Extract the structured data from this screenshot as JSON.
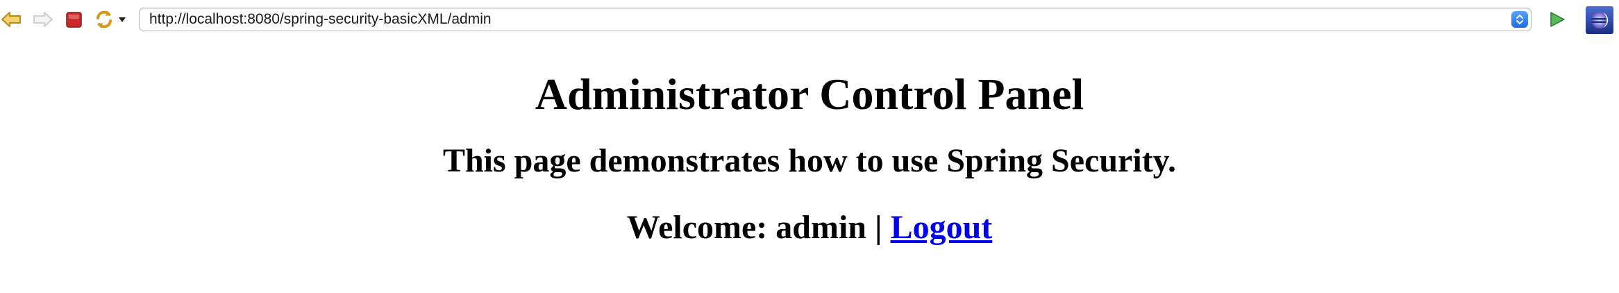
{
  "browser": {
    "url": "http://localhost:8080/spring-security-basicXML/admin",
    "icons": {
      "back": "back-arrow-icon",
      "forward": "forward-arrow-icon",
      "stop": "stop-icon",
      "refresh": "refresh-icon",
      "refresh_menu": "chevron-down-icon",
      "url_menu": "chevron-updown-icon",
      "go": "go-play-icon",
      "logo": "eclipse-logo-icon"
    },
    "colors": {
      "stop": "#cc2b2b",
      "go": "#3c9a3c",
      "url_menu": "#1f6de3"
    }
  },
  "page": {
    "heading": "Administrator Control Panel",
    "subheading": "This page demonstrates how to use Spring Security.",
    "welcome_label": "Welcome: admin | ",
    "logout_link": "Logout",
    "link_color": "#0000ee"
  }
}
